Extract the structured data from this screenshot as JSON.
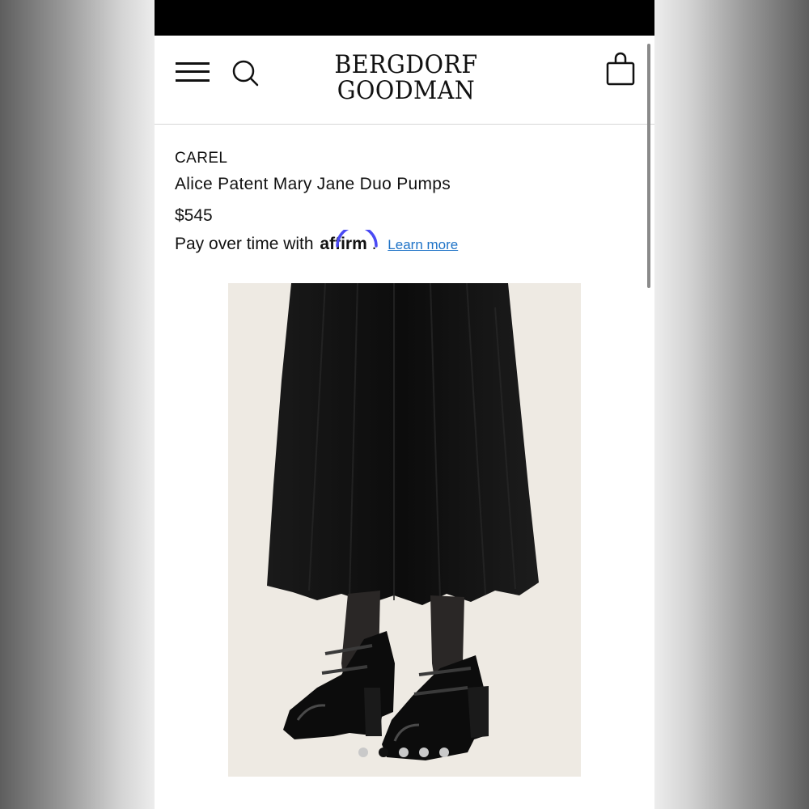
{
  "header": {
    "logo_line1": "BERGDORF",
    "logo_line2": "GOODMAN"
  },
  "product": {
    "brand": "CAREL",
    "name": "Alice Patent Mary Jane Duo Pumps",
    "price": "$545",
    "financing_text": "Pay over time with",
    "financing_provider": "affirm",
    "financing_period": ".",
    "learn_more": "Learn more"
  },
  "carousel": {
    "slide_count": 5,
    "active_index": 1
  },
  "colors": {
    "link": "#1f73c7",
    "affirm_arc": "#4a4af4",
    "image_bg": "#eeeae3",
    "dot_active": "#111111",
    "dot_inactive": "#c9c9c9"
  },
  "icons": [
    "menu-icon",
    "search-icon",
    "shopping-bag-icon"
  ]
}
